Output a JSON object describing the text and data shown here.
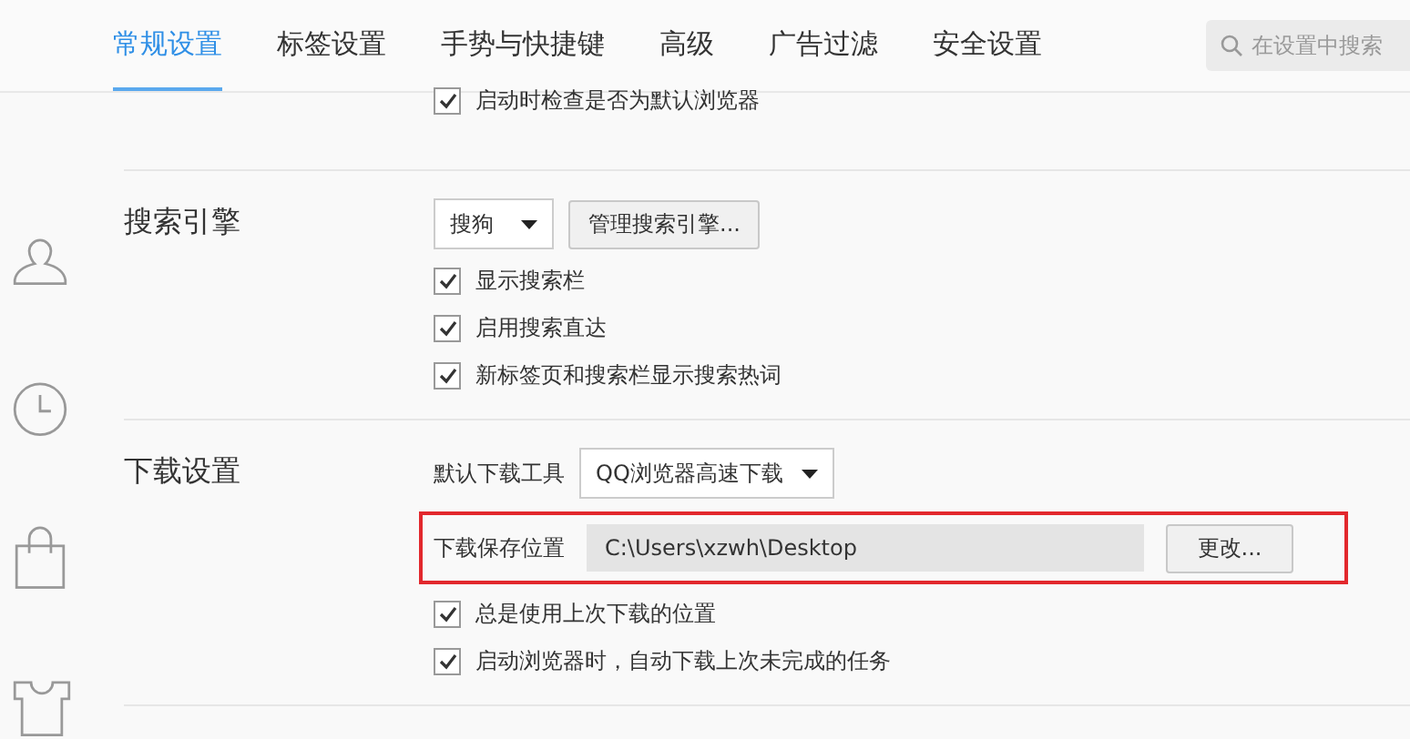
{
  "tabs": [
    {
      "label": "常规设置",
      "selected": true
    },
    {
      "label": "标签设置",
      "selected": false
    },
    {
      "label": "手势与快捷键",
      "selected": false
    },
    {
      "label": "高级",
      "selected": false
    },
    {
      "label": "广告过滤",
      "selected": false
    },
    {
      "label": "安全设置",
      "selected": false
    }
  ],
  "search": {
    "placeholder": "在设置中搜索"
  },
  "top_option": {
    "label": "启动时检查是否为默认浏览器",
    "checked": true
  },
  "sections": [
    {
      "title": "搜索引擎",
      "rows": [
        {
          "kind": "select_button",
          "value": "搜狗",
          "button": "管理搜索引擎..."
        },
        {
          "kind": "checkbox",
          "label": "显示搜索栏",
          "checked": true
        },
        {
          "kind": "checkbox",
          "label": "启用搜索直达",
          "checked": true
        },
        {
          "kind": "checkbox",
          "label": "新标签页和搜索栏显示搜索热词",
          "checked": true
        }
      ]
    },
    {
      "title": "下载设置",
      "rows": [
        {
          "kind": "labeled_select",
          "label": "默认下载工具",
          "value": "QQ浏览器高速下载"
        },
        {
          "kind": "path",
          "label": "下载保存位置",
          "value": "C:\\Users\\xzwh\\Desktop",
          "button": "更改...",
          "highlighted": true
        },
        {
          "kind": "checkbox",
          "label": "总是使用上次下载的位置",
          "checked": true
        },
        {
          "kind": "checkbox",
          "label": "启动浏览器时，自动下载上次未完成的任务",
          "checked": true
        }
      ]
    }
  ]
}
